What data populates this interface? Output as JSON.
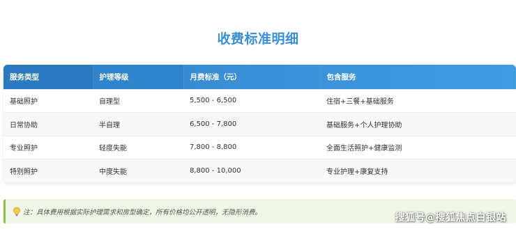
{
  "page": {
    "title": "收费标准明细",
    "accent_color": "#3b8fd6"
  },
  "table": {
    "headers": [
      "服务类型",
      "护理等级",
      "月费标准（元）",
      "包含服务"
    ],
    "rows": [
      [
        "基础照护",
        "自理型",
        "5,500 - 6,500",
        "住宿+三餐+基础服务"
      ],
      [
        "日常协助",
        "半自理",
        "6,500 - 7,800",
        "基础服务+个人护理协助"
      ],
      [
        "专业照护",
        "轻度失能",
        "7,800 - 8,800",
        "全面生活照护+健康监测"
      ],
      [
        "特别照护",
        "中度失能",
        "8,800 - 10,000",
        "专业护理+康复支持"
      ]
    ]
  },
  "note": {
    "icon": "lightbulb-icon",
    "text": "注：具体费用根据实际护理需求和房型确定，所有价格均公开透明，无隐形消费。"
  },
  "watermark": {
    "text": "搜狐号@搜狐焦点白银站"
  }
}
